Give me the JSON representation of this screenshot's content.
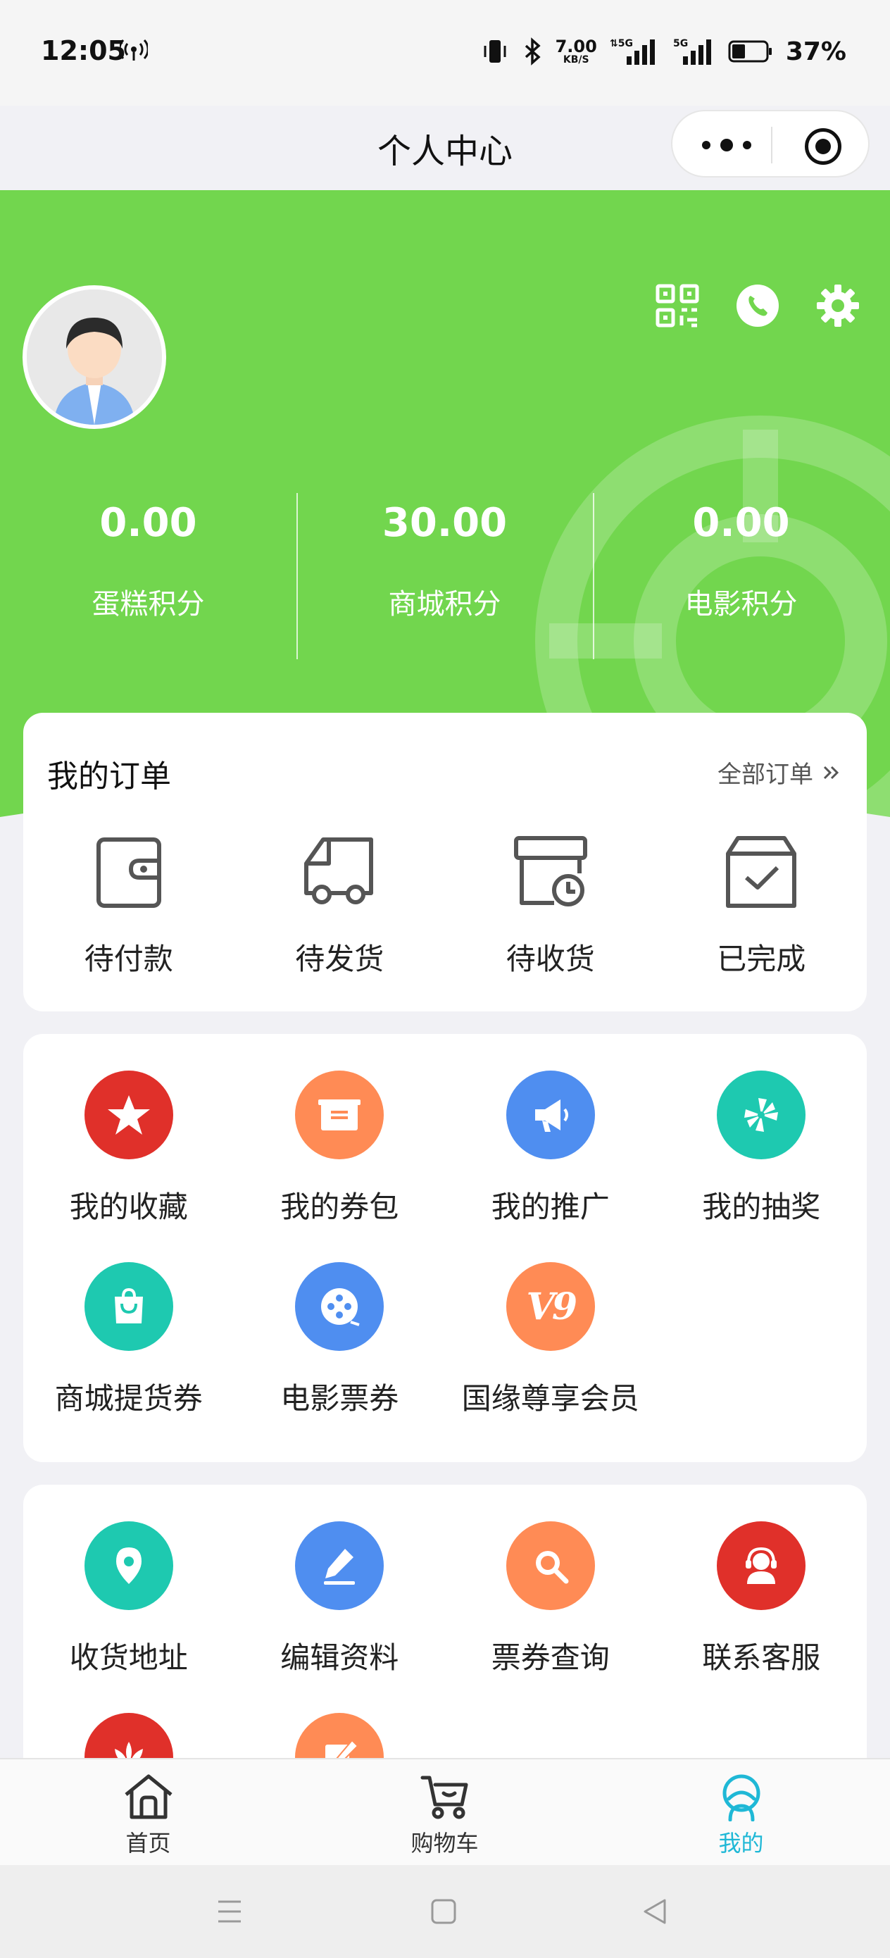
{
  "status_bar": {
    "time": "12:05",
    "net_speed": "7.00",
    "net_unit": "KB/S",
    "battery": "37%",
    "icons": [
      "hotspot-icon",
      "vibrate-icon",
      "bluetooth-icon",
      "signal-5g-icon",
      "signal-5g-icon",
      "battery-icon"
    ]
  },
  "nav": {
    "title": "个人中心"
  },
  "profile": {
    "points": [
      {
        "value": "0.00",
        "label": "蛋糕积分"
      },
      {
        "value": "30.00",
        "label": "商城积分"
      },
      {
        "value": "0.00",
        "label": "电影积分"
      }
    ],
    "header_icons": [
      "qrcode-icon",
      "phone-icon",
      "settings-icon"
    ]
  },
  "orders": {
    "title": "我的订单",
    "all_label": "全部订单",
    "items": [
      {
        "label": "待付款",
        "icon": "wallet-icon"
      },
      {
        "label": "待发货",
        "icon": "truck-icon"
      },
      {
        "label": "待收货",
        "icon": "box-clock-icon"
      },
      {
        "label": "已完成",
        "icon": "box-check-icon"
      }
    ]
  },
  "services": {
    "items": [
      {
        "label": "我的收藏",
        "icon": "star-icon",
        "color": "#e0302a"
      },
      {
        "label": "我的券包",
        "icon": "coupon-icon",
        "color": "#ff8b55"
      },
      {
        "label": "我的推广",
        "icon": "megaphone-icon",
        "color": "#4f8ef0"
      },
      {
        "label": "我的抽奖",
        "icon": "pinwheel-icon",
        "color": "#1ec9b0"
      },
      {
        "label": "商城提货券",
        "icon": "shopping-bag-icon",
        "color": "#1ec9b0"
      },
      {
        "label": "电影票券",
        "icon": "film-reel-icon",
        "color": "#4f8ef0"
      },
      {
        "label": "国缘尊享会员",
        "icon": "v9-logo-icon",
        "color": "#ff8b55",
        "badge_text": "V9"
      }
    ]
  },
  "tools": {
    "items": [
      {
        "label": "收货地址",
        "icon": "location-pin-icon",
        "color": "#1ec9b0"
      },
      {
        "label": "编辑资料",
        "icon": "edit-pen-icon",
        "color": "#4f8ef0"
      },
      {
        "label": "票券查询",
        "icon": "search-icon",
        "color": "#ff8b55"
      },
      {
        "label": "联系客服",
        "icon": "customer-service-icon",
        "color": "#e0302a"
      },
      {
        "label": "",
        "icon": "lotus-icon",
        "color": "#e0302a"
      },
      {
        "label": "",
        "icon": "edit-note-icon",
        "color": "#ff8b55"
      }
    ]
  },
  "tabbar": {
    "tabs": [
      {
        "label": "首页",
        "icon": "home-icon",
        "active": false
      },
      {
        "label": "购物车",
        "icon": "cart-icon",
        "active": false
      },
      {
        "label": "我的",
        "icon": "profile-icon",
        "active": true
      }
    ],
    "active_color": "#1fb8d6"
  },
  "theme": {
    "brand_green": "#72d64e",
    "background": "#f1f1f5"
  }
}
